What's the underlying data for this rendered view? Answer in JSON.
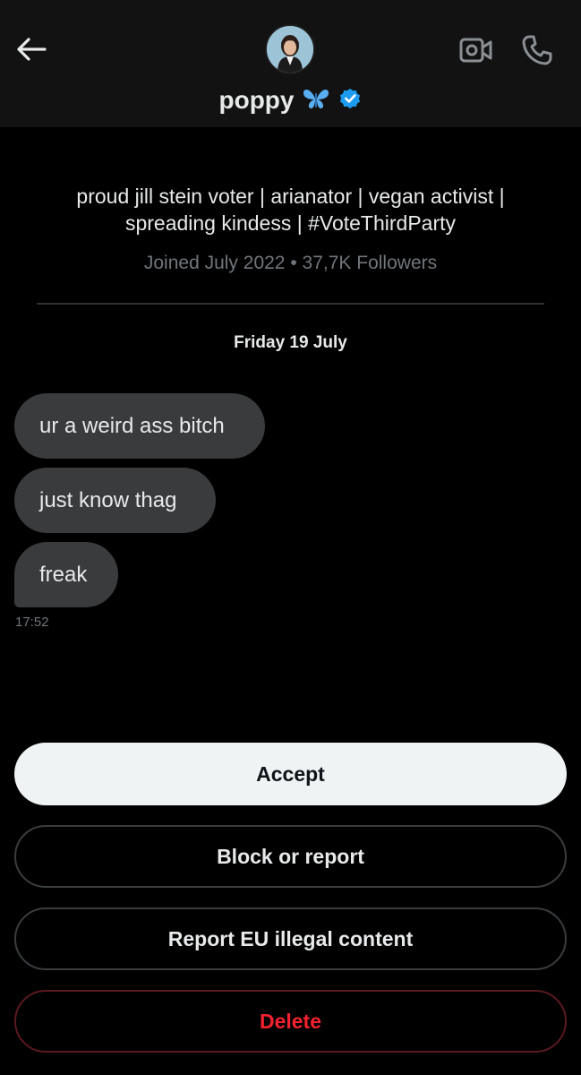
{
  "header": {
    "name": "poppy",
    "name_emoji": "🦋",
    "verified_color": "#1d9bf0",
    "icons": [
      "arrow-left-icon",
      "video-camera-icon",
      "phone-icon",
      "verified-badge-icon",
      "butterfly-icon"
    ]
  },
  "profile": {
    "bio_line1": "proud jill stein voter | arianator | vegan activist |",
    "bio_line2": "spreading kindess | #VoteThirdParty",
    "joined": "Joined July 2022",
    "separator": "•",
    "followers": "37,7K Followers"
  },
  "conversation": {
    "date": "Friday 19 July",
    "messages": [
      {
        "text": "ur a weird ass bitch"
      },
      {
        "text": "just know thag"
      },
      {
        "text": "freak"
      }
    ],
    "time": "17:52"
  },
  "actions": {
    "accept": "Accept",
    "block": "Block or report",
    "report_eu": "Report EU illegal content",
    "delete": "Delete"
  }
}
